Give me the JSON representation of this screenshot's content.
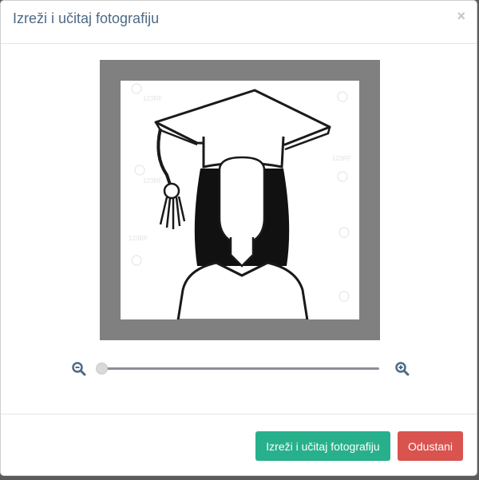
{
  "dialog": {
    "title": "Izreži i učitaj fotografiju",
    "close_label": "×"
  },
  "cropper": {
    "image_description_icon": "graduate-avatar-icon",
    "watermark_text": "123RF",
    "zoom_out_icon": "zoom-out-icon",
    "zoom_in_icon": "zoom-in-icon",
    "zoom_level": 0
  },
  "footer": {
    "upload_button_label": "Izreži i učitaj fotografiju",
    "cancel_button_label": "Odustani"
  },
  "colors": {
    "title": "#4d6a85",
    "primary_button": "#28b08c",
    "danger_button": "#d9534f",
    "crop_frame": "#808080",
    "zoom_icon": "#4d6a85"
  }
}
